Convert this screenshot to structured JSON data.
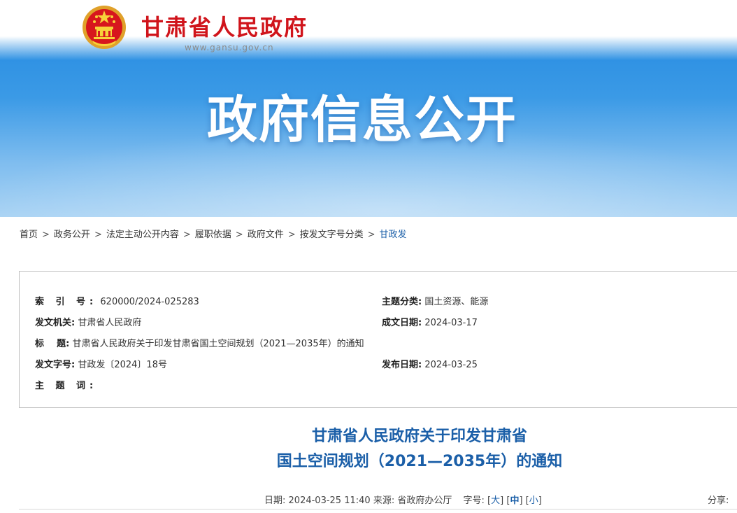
{
  "header": {
    "site_name": "甘肃省人民政府",
    "site_url": "www.gansu.gov.cn",
    "hero_title": "政府信息公开"
  },
  "breadcrumb": [
    "首页",
    "政务公开",
    "法定主动公开内容",
    "履职依据",
    "政府文件",
    "按发文字号分类",
    "甘政发"
  ],
  "meta": {
    "index_label": "索 引 号:",
    "index_value": "620000/2024-025283",
    "topic_label": "主题分类:",
    "topic_value": "国土资源、能源",
    "issuer_label": "发文机关:",
    "issuer_value": "甘肃省人民政府",
    "written_label": "成文日期:",
    "written_value": "2024-03-17",
    "title_label": "标    题:",
    "title_value": "甘肃省人民政府关于印发甘肃省国土空间规划（2021—2035年）的通知",
    "docno_label": "发文字号:",
    "docno_value": "甘政发〔2024〕18号",
    "published_label": "发布日期:",
    "published_value": "2024-03-25",
    "keywords_label": "主 题 词:"
  },
  "article": {
    "title_line1": "甘肃省人民政府关于印发甘肃省",
    "title_line2": "国土空间规划（2021—2035年）的通知",
    "date_label": "日期:",
    "date_value": "2024-03-25 11:40",
    "source_label": "来源:",
    "source_value": "省政府办公厅",
    "fontsize_label": "字号:",
    "fs_large": "大",
    "fs_medium": "中",
    "fs_small": "小",
    "share_label": "分享:"
  },
  "colors": {
    "brand_red": "#d0141b",
    "link_blue": "#1b5fa8",
    "banner_blue": "#1f86df"
  }
}
